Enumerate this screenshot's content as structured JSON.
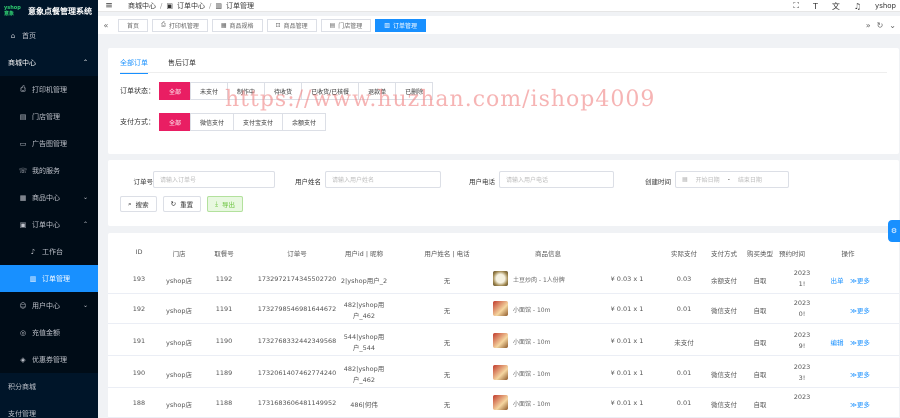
{
  "app": {
    "title": "意象点餐管理系统",
    "logo_top": "yshop",
    "logo_bottom": "意象"
  },
  "sidebar": {
    "items": [
      {
        "icon": "home-icon",
        "glyph": "⌂",
        "label": "首页"
      },
      {
        "icon": "",
        "glyph": "",
        "label": "商城中心"
      },
      {
        "icon": "printer-icon",
        "glyph": "⎙",
        "label": "打印机管理"
      },
      {
        "icon": "store-icon",
        "glyph": "▤",
        "label": "门店管理"
      },
      {
        "icon": "ad-icon",
        "glyph": "▭",
        "label": "广告图管理"
      },
      {
        "icon": "service-icon",
        "glyph": "☏",
        "label": "我的服务"
      },
      {
        "icon": "goods-icon",
        "glyph": "▦",
        "label": "商品中心"
      },
      {
        "icon": "order-icon",
        "glyph": "▣",
        "label": "订单中心"
      },
      {
        "icon": "bell-icon",
        "glyph": "♪",
        "label": "工作台"
      },
      {
        "icon": "list-icon",
        "glyph": "▥",
        "label": "订单管理"
      },
      {
        "icon": "user-icon",
        "glyph": "☺",
        "label": "用户中心"
      },
      {
        "icon": "balance-icon",
        "glyph": "◎",
        "label": "充值金额"
      },
      {
        "icon": "coupon-icon",
        "glyph": "◈",
        "label": "优惠券管理"
      },
      {
        "icon": "",
        "glyph": "",
        "label": "积分商城"
      },
      {
        "icon": "",
        "glyph": "",
        "label": "支付管理"
      }
    ]
  },
  "topbar": {
    "crumb1": "商城中心",
    "crumb2": "订单中心",
    "crumb3": "订单管理",
    "user": "yshop"
  },
  "tags": [
    "首页",
    "打印机管理",
    "商品规格",
    "商品管理",
    "门店管理",
    "订单管理"
  ],
  "order_tabs": [
    "全部订单",
    "售后订单"
  ],
  "filters": {
    "status_label": "订单状态：",
    "status_options": [
      "全部",
      "未支付",
      "制作中",
      "待收货",
      "已收货/已核餐",
      "退款单",
      "已删除"
    ],
    "pay_label": "支付方式：",
    "pay_options": [
      "全部",
      "微信支付",
      "支付宝支付",
      "余额支付"
    ]
  },
  "search": {
    "order_no_label": "订单号",
    "order_no_placeholder": "请输入订单号",
    "user_name_label": "用户姓名",
    "user_name_placeholder": "请输入用户姓名",
    "user_phone_label": "用户电话",
    "user_phone_placeholder": "请输入用户电话",
    "created_label": "创建时间",
    "start_placeholder": "开始日期",
    "range_sep": "-",
    "end_placeholder": "结束日期",
    "search_btn": "搜索",
    "reset_btn": "重置",
    "export_btn": "导出"
  },
  "table": {
    "headers": [
      "ID",
      "门店",
      "取餐号",
      "订单号",
      "用户id | 昵称",
      "用户姓名 | 电话",
      "商品信息",
      "实际支付",
      "支付方式",
      "购买类型",
      "预约时间",
      "操作"
    ],
    "rows": [
      {
        "id": "193",
        "store": "yshop店",
        "pick": "1192",
        "order_no": "1732972174345502720",
        "user1": "2|yshop用户_2",
        "user2": "",
        "name": "无",
        "goods": "土豆炒肉 - 1人份牌",
        "price": "¥ 0.03 x 1",
        "paid": "0.03",
        "pay": "余额支付",
        "buy": "自取",
        "time1": "2023",
        "time2": "1!",
        "ops1": "出单",
        "ops2": "≫更多",
        "thumb": "rice"
      },
      {
        "id": "192",
        "store": "yshop店",
        "pick": "1191",
        "order_no": "1732798546981644672",
        "user1": "482|yshop用",
        "user2": "户_462",
        "name": "无",
        "goods": "小面馆 - 10m",
        "price": "¥ 0.01 x 1",
        "paid": "0.01",
        "pay": "微信支付",
        "buy": "自取",
        "time1": "2023",
        "time2": "0!",
        "ops1": "",
        "ops2": "≫更多",
        "thumb": "noodle"
      },
      {
        "id": "191",
        "store": "yshop店",
        "pick": "1190",
        "order_no": "1732768332442349568",
        "user1": "544|yshop用",
        "user2": "户_544",
        "name": "无",
        "goods": "小面馆 - 10m",
        "price": "¥ 0.01 x 1",
        "paid": "未支付",
        "pay": "",
        "buy": "自取",
        "time1": "2023",
        "time2": "9!",
        "ops1": "编辑",
        "ops2": "≫更多",
        "thumb": "noodle"
      },
      {
        "id": "190",
        "store": "yshop店",
        "pick": "1189",
        "order_no": "1732061407462774240",
        "user1": "482|yshop用",
        "user2": "户_462",
        "name": "无",
        "goods": "小面馆 - 10m",
        "price": "¥ 0.01 x 1",
        "paid": "0.01",
        "pay": "微信支付",
        "buy": "自取",
        "time1": "2023",
        "time2": "3!",
        "ops1": "",
        "ops2": "≫更多",
        "thumb": "noodle"
      },
      {
        "id": "188",
        "store": "yshop店",
        "pick": "1188",
        "order_no": "1731683606481149952",
        "user1": "486|何伟",
        "user2": "",
        "name": "无",
        "goods": "小面馆 - 10m",
        "price": "¥ 0.01 x 1",
        "paid": "0.01",
        "pay": "微信支付",
        "buy": "自取",
        "time1": "2023",
        "time2": "",
        "ops1": "",
        "ops2": "≫更多",
        "thumb": "noodle"
      }
    ]
  },
  "watermark": "https://www.huzhan.com/ishop4009"
}
